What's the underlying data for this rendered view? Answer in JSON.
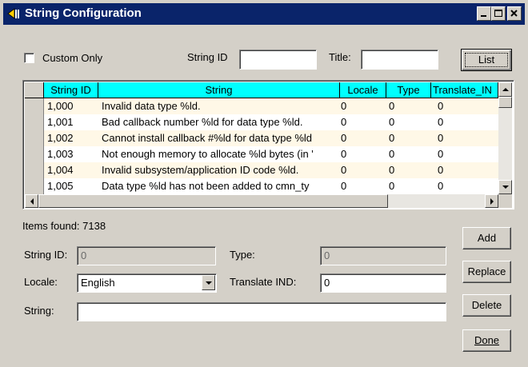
{
  "window": {
    "title": "String Configuration"
  },
  "filters": {
    "custom_only_label": "Custom Only",
    "custom_only_checked": false,
    "string_id_label": "String ID",
    "string_id_value": "",
    "title_label": "Title:",
    "title_value": "",
    "list_button": "List"
  },
  "table": {
    "columns": [
      "String ID",
      "String",
      "Locale",
      "Type",
      "Translate_IN"
    ],
    "rows": [
      [
        "1,000",
        "Invalid data type %ld.",
        "0",
        "0",
        "0"
      ],
      [
        "1,001",
        "Bad callback number %ld for data type %ld.",
        "0",
        "0",
        "0"
      ],
      [
        "1,002",
        "Cannot install callback #%ld for data type %ld",
        "0",
        "0",
        "0"
      ],
      [
        "1,003",
        "Not enough memory to allocate %ld bytes (in '",
        "0",
        "0",
        "0"
      ],
      [
        "1,004",
        "Invalid subsystem/application ID code %ld.",
        "0",
        "0",
        "0"
      ],
      [
        "1,005",
        "Data type %ld has not been added to cmn_ty",
        "0",
        "0",
        "0"
      ]
    ]
  },
  "status": {
    "items_found": "Items found: 7138"
  },
  "form": {
    "string_id_label": "String ID:",
    "string_id_value": "0",
    "type_label": "Type:",
    "type_value": "0",
    "locale_label": "Locale:",
    "locale_value": "English",
    "translate_label": "Translate IND:",
    "translate_value": "0",
    "string_label": "String:",
    "string_value": ""
  },
  "buttons": {
    "add": "Add",
    "replace": "Replace",
    "delete": "Delete",
    "done": "Done"
  },
  "icons": [
    "app-icon",
    "minimize-icon",
    "maximize-icon",
    "close-icon",
    "scroll-up-icon",
    "scroll-down-icon",
    "scroll-left-icon",
    "scroll-right-icon",
    "dropdown-arrow-icon"
  ],
  "colors": {
    "titlebar": "#0a246a",
    "grid_header": "#00ffff",
    "row_alt": "#fff8e7",
    "face": "#d4d0c8"
  }
}
